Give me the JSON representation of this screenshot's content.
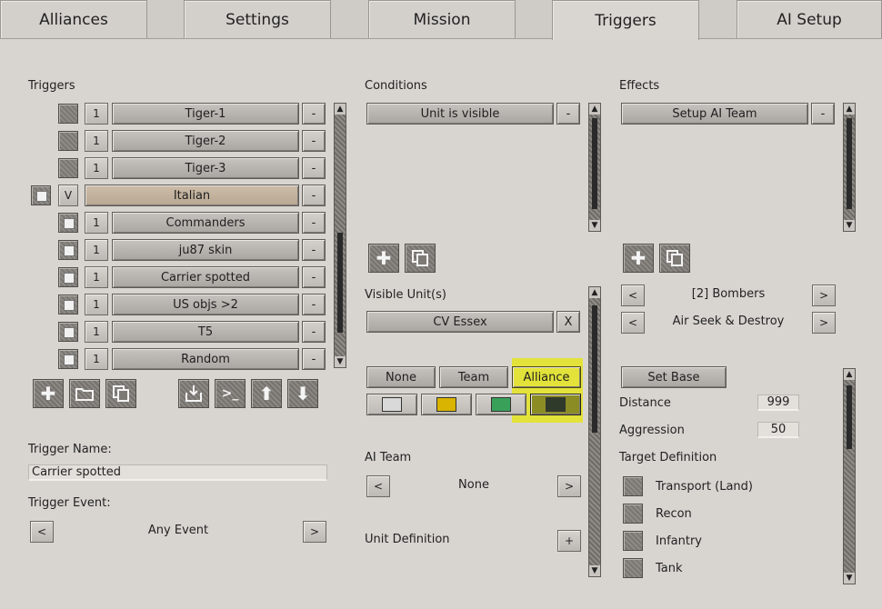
{
  "tabs": [
    "Alliances",
    "Settings",
    "Mission",
    "Triggers",
    "AI Setup"
  ],
  "active_tab": "Triggers",
  "triggers": {
    "title": "Triggers",
    "items": [
      {
        "num": "1",
        "name": "Tiger-1",
        "remove": "-"
      },
      {
        "num": "1",
        "name": "Tiger-2",
        "remove": "-"
      },
      {
        "num": "1",
        "name": "Tiger-3",
        "remove": "-"
      },
      {
        "num": "V",
        "name": "Italian",
        "remove": "-"
      },
      {
        "num": "1",
        "name": "Commanders",
        "remove": "-"
      },
      {
        "num": "1",
        "name": "ju87 skin",
        "remove": "-"
      },
      {
        "num": "1",
        "name": "Carrier spotted",
        "remove": "-"
      },
      {
        "num": "1",
        "name": "US objs >2",
        "remove": "-"
      },
      {
        "num": "1",
        "name": "T5",
        "remove": "-"
      },
      {
        "num": "1",
        "name": "Random",
        "remove": "-"
      }
    ],
    "trigger_name_label": "Trigger Name:",
    "trigger_name_value": "Carrier spotted",
    "trigger_event_label": "Trigger Event:",
    "trigger_event_value": "Any Event",
    "prev": "<",
    "next": ">",
    "icons": [
      "plus-icon",
      "folder-icon",
      "copy-icon",
      "import-icon",
      "console-icon",
      "arrow-up-icon",
      "arrow-down-icon"
    ]
  },
  "conditions": {
    "title": "Conditions",
    "items": [
      {
        "name": "Unit is visible",
        "remove": "-"
      }
    ],
    "visible_units_label": "Visible Unit(s)",
    "visible_unit": "CV Essex",
    "visible_unit_remove": "X",
    "filter_buttons": [
      "None",
      "Team",
      "Alliance"
    ],
    "selected_filter": "Alliance",
    "swatch_colors": [
      "#d9d9d9",
      "#d9b400",
      "#39a05a",
      "#2f3a2a"
    ],
    "ai_team_label": "AI Team",
    "ai_team_value": "None",
    "prev": "<",
    "next": ">",
    "unit_definition_label": "Unit Definition",
    "unit_definition_add": "+"
  },
  "effects": {
    "title": "Effects",
    "items": [
      {
        "name": "Setup AI Team",
        "remove": "-"
      }
    ],
    "selectors": [
      {
        "prev": "<",
        "value": "[2] Bombers",
        "next": ">"
      },
      {
        "prev": "<",
        "value": "Air Seek & Destroy",
        "next": ">"
      }
    ],
    "set_base_label": "Set Base",
    "distance_label": "Distance",
    "distance_value": "999",
    "aggression_label": "Aggression",
    "aggression_value": "50",
    "target_definition_label": "Target Definition",
    "targets": [
      "Transport (Land)",
      "Recon",
      "Infantry",
      "Tank"
    ]
  },
  "colors": {
    "highlight": "#e6e800",
    "selected_trigger": "#c4b39f"
  }
}
